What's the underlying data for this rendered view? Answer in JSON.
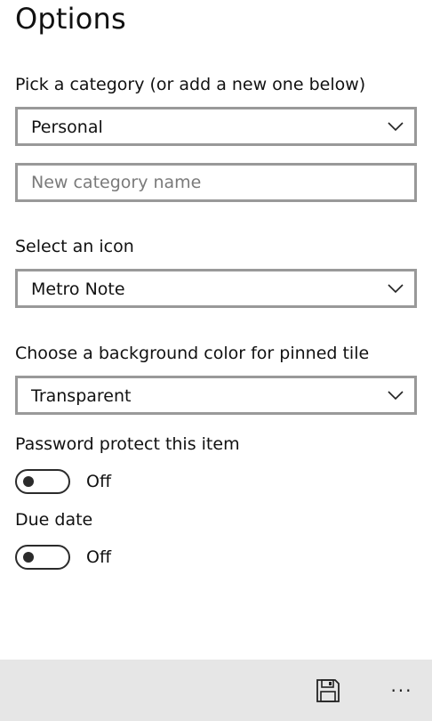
{
  "page": {
    "title": "Options"
  },
  "category": {
    "label": "Pick a category (or add a new one below)",
    "selected": "Personal",
    "new_placeholder": "New category name",
    "new_value": ""
  },
  "icon": {
    "label": "Select an icon",
    "selected": "Metro Note"
  },
  "background": {
    "label": "Choose a background color for pinned tile",
    "selected": "Transparent"
  },
  "password": {
    "label": "Password protect this item",
    "state": "Off",
    "on": false
  },
  "due_date": {
    "label": "Due date",
    "state": "Off",
    "on": false
  },
  "app_bar": {
    "icons": [
      "save-icon",
      "more-icon"
    ],
    "more_glyph": "···",
    "background": "#e6e6e6"
  },
  "colors": {
    "border": "#999999",
    "placeholder": "#7a7a7a",
    "text": "#111111"
  }
}
